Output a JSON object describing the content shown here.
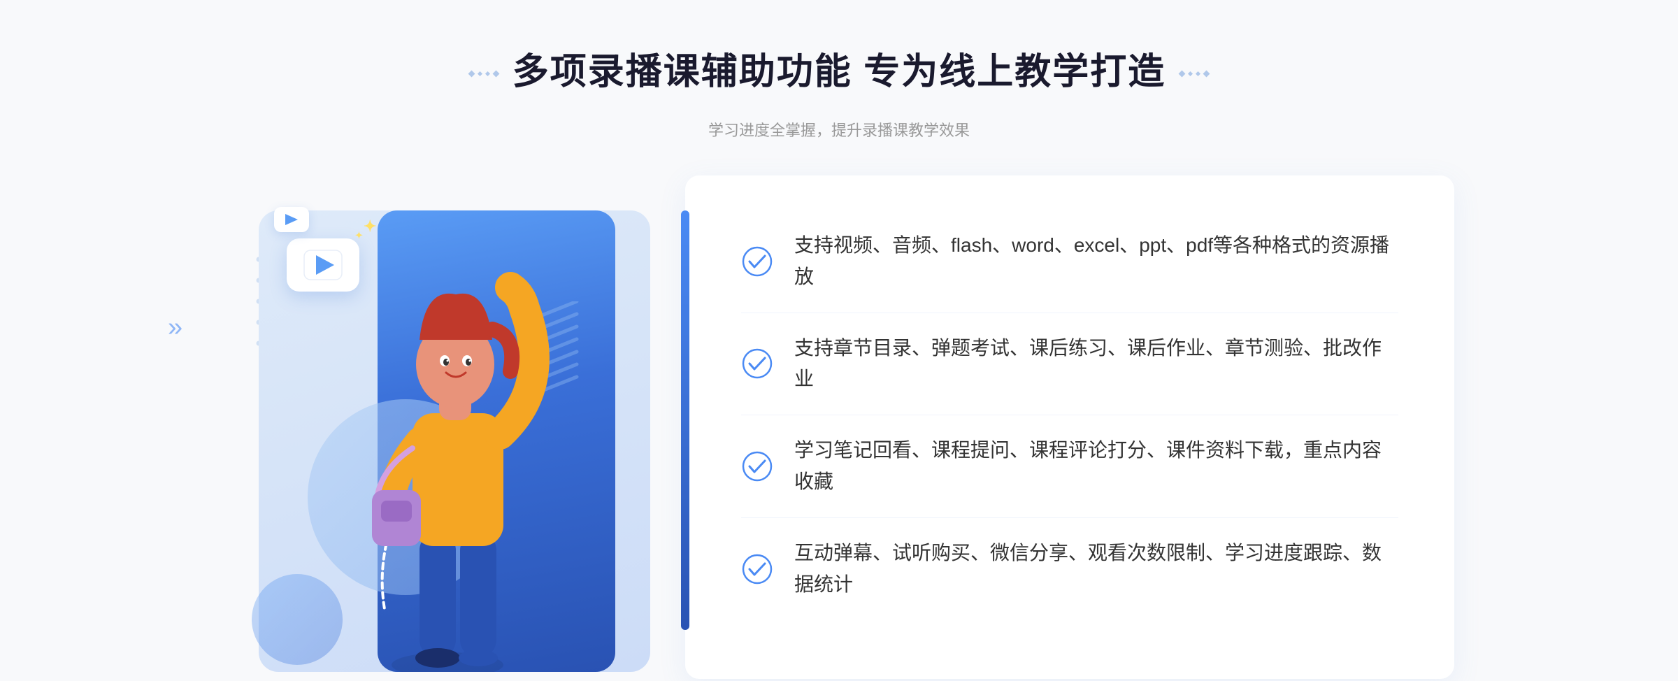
{
  "page": {
    "background": "#f5f7fb"
  },
  "header": {
    "title": "多项录播课辅助功能 专为线上教学打造",
    "subtitle": "学习进度全掌握，提升录播课教学效果",
    "decoration_left": "⁚",
    "decoration_right": "⁚"
  },
  "features": [
    {
      "id": 1,
      "text": "支持视频、音频、flash、word、excel、ppt、pdf等各种格式的资源播放"
    },
    {
      "id": 2,
      "text": "支持章节目录、弹题考试、课后练习、课后作业、章节测验、批改作业"
    },
    {
      "id": 3,
      "text": "学习笔记回看、课程提问、课程评论打分、课件资料下载，重点内容收藏"
    },
    {
      "id": 4,
      "text": "互动弹幕、试听购买、微信分享、观看次数限制、学习进度跟踪、数据统计"
    }
  ],
  "colors": {
    "primary_blue": "#4a8af4",
    "dark_blue": "#2952b3",
    "light_blue": "#d0e4fa",
    "text_dark": "#333333",
    "text_gray": "#999999",
    "accent": "#5a9cf5"
  },
  "icons": {
    "check": "check-circle-icon",
    "play": "play-icon",
    "chevron": "chevron-right-icon"
  }
}
